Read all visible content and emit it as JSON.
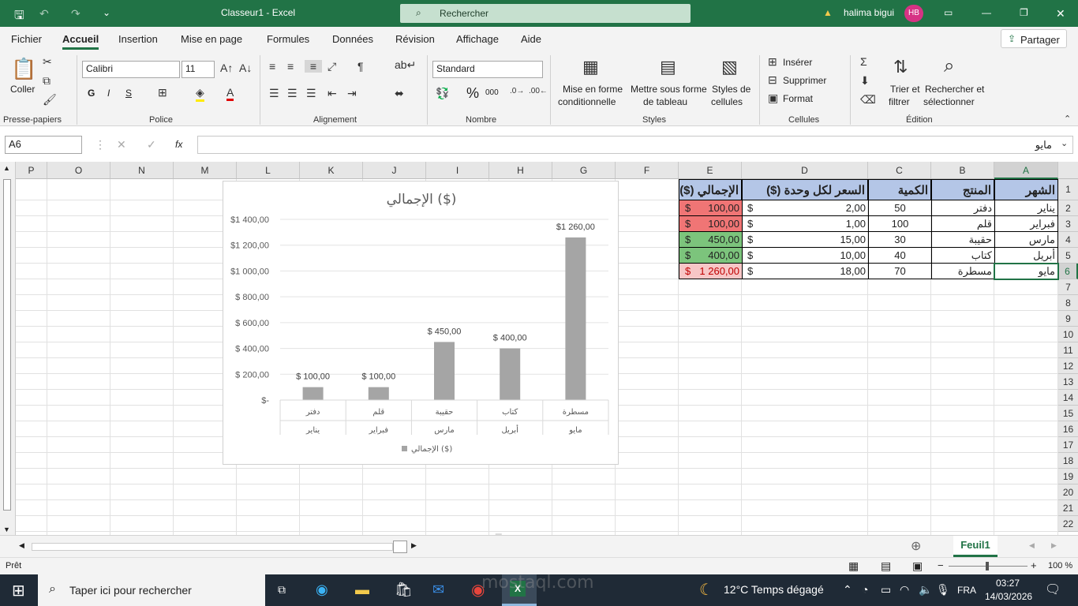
{
  "window": {
    "title": "Classeur1  -  Excel",
    "search_placeholder": "Rechercher",
    "user_name": "halima bigui",
    "user_initials": "HB"
  },
  "menu": {
    "items": [
      "Fichier",
      "Accueil",
      "Insertion",
      "Mise en page",
      "Formules",
      "Données",
      "Révision",
      "Affichage",
      "Aide"
    ],
    "share": "Partager"
  },
  "ribbon": {
    "clipboard": {
      "paste": "Coller",
      "group": "Presse-papiers"
    },
    "font": {
      "name": "Calibri",
      "size": "11",
      "bold": "G",
      "italic": "I",
      "underline": "S",
      "group": "Police"
    },
    "alignment": {
      "group": "Alignement"
    },
    "number": {
      "format": "Standard",
      "group": "Nombre",
      "percent": "%",
      "thousands": "000"
    },
    "styles": {
      "conditional_1": "Mise en forme",
      "conditional_2": "conditionnelle",
      "table_1": "Mettre sous forme",
      "table_2": "de tableau",
      "cell_styles_1": "Styles de",
      "cell_styles_2": "cellules",
      "group": "Styles"
    },
    "cells": {
      "insert": "Insérer",
      "delete": "Supprimer",
      "format": "Format",
      "group": "Cellules"
    },
    "editing": {
      "sort_1": "Trier et",
      "sort_2": "filtrer",
      "find_1": "Rechercher et",
      "find_2": "sélectionner",
      "group": "Édition"
    }
  },
  "formula_bar": {
    "name_box": "A6",
    "fx": "fx",
    "content": "مايو"
  },
  "columns": [
    "P",
    "O",
    "N",
    "M",
    "L",
    "K",
    "J",
    "I",
    "H",
    "G",
    "F",
    "E",
    "D",
    "C",
    "B",
    "A"
  ],
  "rows": [
    "1",
    "2",
    "3",
    "4",
    "5",
    "6",
    "7",
    "8",
    "9",
    "10",
    "11",
    "12",
    "13",
    "14",
    "15",
    "16",
    "17",
    "18",
    "19",
    "20",
    "21",
    "22"
  ],
  "table": {
    "headers": [
      "الشهر",
      "المنتج",
      "الكمية",
      "السعر لكل وحدة ($)",
      "الإجمالي ($)"
    ],
    "rows": [
      {
        "month": "يناير",
        "product": "دفتر",
        "qty": "50",
        "cur": "$",
        "price": "2,00",
        "tcur": "$",
        "total": "100,00"
      },
      {
        "month": "فبراير",
        "product": "قلم",
        "qty": "100",
        "cur": "$",
        "price": "1,00",
        "tcur": "$",
        "total": "100,00"
      },
      {
        "month": "مارس",
        "product": "حقيبة",
        "qty": "30",
        "cur": "$",
        "price": "15,00",
        "tcur": "$",
        "total": "450,00"
      },
      {
        "month": "أبريل",
        "product": "كتاب",
        "qty": "40",
        "cur": "$",
        "price": "10,00",
        "tcur": "$",
        "total": "400,00"
      },
      {
        "month": "مايو",
        "product": "مسطرة",
        "qty": "70",
        "cur": "$",
        "price": "18,00",
        "tcur": "$",
        "total": "1 260,00"
      }
    ],
    "total_fills": [
      "#f07575",
      "#f07575",
      "#7cc47c",
      "#7cc47c",
      "#f7c6c6"
    ],
    "header_fill": "#b4c6e7"
  },
  "chart_data": {
    "type": "bar",
    "title": "الإجمالي ($)",
    "categories": [
      "دفتر",
      "قلم",
      "حقيبة",
      "كتاب",
      "مسطرة"
    ],
    "categories_outer": [
      "يناير",
      "فبراير",
      "مارس",
      "أبريل",
      "مايو"
    ],
    "series": [
      {
        "name": "الإجمالي ($)",
        "values": [
          100,
          100,
          450,
          400,
          1260
        ]
      }
    ],
    "data_labels": [
      "$ 100,00",
      "$ 100,00",
      "$ 450,00",
      "$ 400,00",
      "$1 260,00"
    ],
    "y_ticks": [
      "$-",
      "$ 200,00",
      "$ 400,00",
      "$ 600,00",
      "$ 800,00",
      "$1 000,00",
      "$1 200,00",
      "$1 400,00"
    ],
    "ylim": [
      0,
      1400
    ],
    "legend_position": "bottom",
    "bar_color": "#a5a5a5"
  },
  "sheet_tab": "Feuil1",
  "status": {
    "ready": "Prêt",
    "zoom": "100 %"
  },
  "taskbar": {
    "search": "Taper ici pour rechercher",
    "weather": "12°C  Temps dégagé",
    "lang": "FRA",
    "time": "03:27",
    "date": "14/03/2026"
  },
  "watermark": {
    "main": "مستقل",
    "sub": "mostaql.com"
  },
  "colors": {
    "excel_green": "#217346"
  }
}
